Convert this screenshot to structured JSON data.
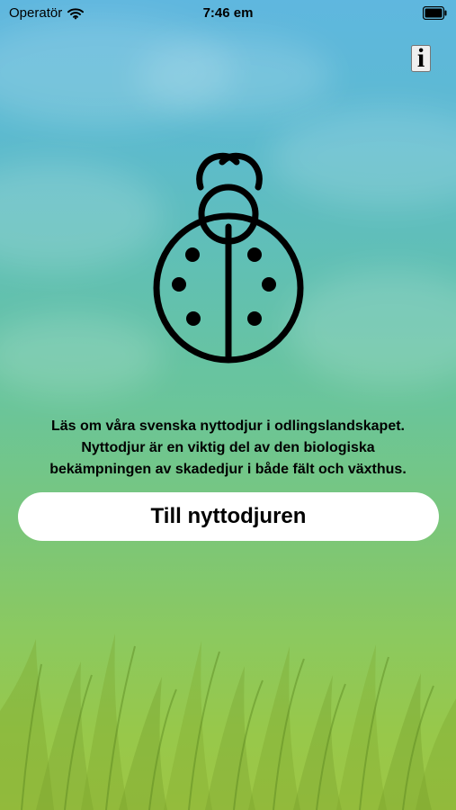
{
  "status_bar": {
    "carrier": "Operatör",
    "time": "7:46 em",
    "wifi_icon": "wifi-icon",
    "battery_icon": "battery-icon"
  },
  "header": {
    "info_label": "i",
    "info_icon": "info-icon"
  },
  "hero": {
    "icon": "ladybug-icon"
  },
  "intro": {
    "lines": [
      "Läs om våra svenska nyttodjur i odlingslandskapet.",
      "Nyttodjur är en viktig del av den biologiska",
      "bekämpningen av skadedjur i både fält och växthus."
    ]
  },
  "actions": {
    "primary_label": "Till nyttodjuren"
  },
  "colors": {
    "sky_top": "#5fb7df",
    "mid": "#6ac59a",
    "grass": "#9ec644",
    "button_bg": "#ffffff",
    "text": "#000000"
  }
}
